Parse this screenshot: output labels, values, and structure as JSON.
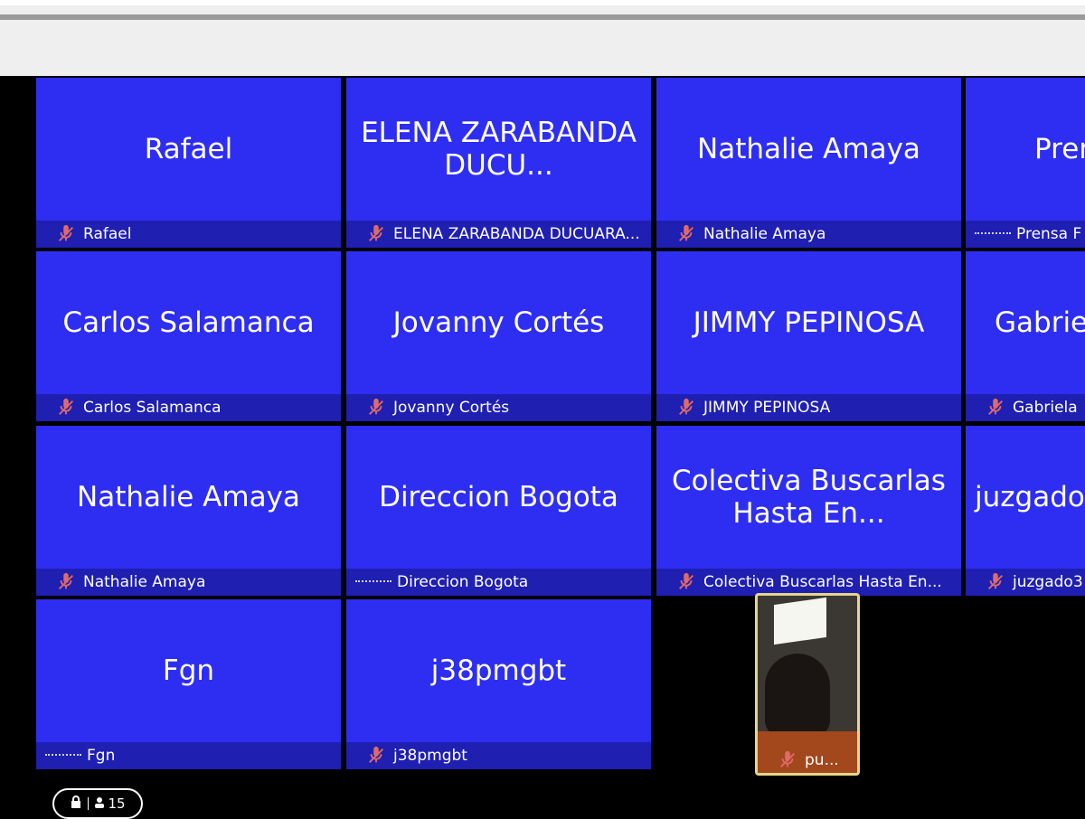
{
  "participants": [
    {
      "display": "Rafael",
      "label": "Rafael",
      "mic": "muted"
    },
    {
      "display": "ELENA ZARABANDA DUCU...",
      "label": "ELENA ZARABANDA DUCUARA...",
      "mic": "muted"
    },
    {
      "display": "Nathalie Amaya",
      "label": "Nathalie Amaya",
      "mic": "muted"
    },
    {
      "display": "Pren",
      "label": "Prensa F",
      "mic": "dots"
    },
    {
      "display": "Carlos Salamanca",
      "label": "Carlos Salamanca",
      "mic": "muted"
    },
    {
      "display": "Jovanny Cortés",
      "label": "Jovanny Cortés",
      "mic": "muted"
    },
    {
      "display": "JIMMY PEPINOSA",
      "label": "JIMMY PEPINOSA",
      "mic": "muted"
    },
    {
      "display": "Gabrie",
      "label": "Gabriela",
      "mic": "muted"
    },
    {
      "display": "Nathalie Amaya",
      "label": "Nathalie Amaya",
      "mic": "muted"
    },
    {
      "display": "Direccion Bogota",
      "label": "Direccion Bogota",
      "mic": "dots"
    },
    {
      "display": "Colectiva Buscarlas Hasta En...",
      "label": "Colectiva Buscarlas Hasta En...",
      "mic": "muted"
    },
    {
      "display": "juzgado",
      "label": "juzgado3",
      "mic": "muted"
    },
    {
      "display": "Fgn",
      "label": "Fgn",
      "mic": "dots"
    },
    {
      "display": "j38pmgbt",
      "label": "j38pmgbt",
      "mic": "muted"
    }
  ],
  "self_view": {
    "label": "pu..."
  },
  "meeting_badge": {
    "count": "15",
    "lock_icon": "lock-icon",
    "people_icon": "people-icon"
  },
  "colors": {
    "tile": "#2e2ef2",
    "tile_bar": "#1f1fb2",
    "background": "#000000",
    "mute_icon": "#e06a6a",
    "self_border": "#e7d58a"
  }
}
